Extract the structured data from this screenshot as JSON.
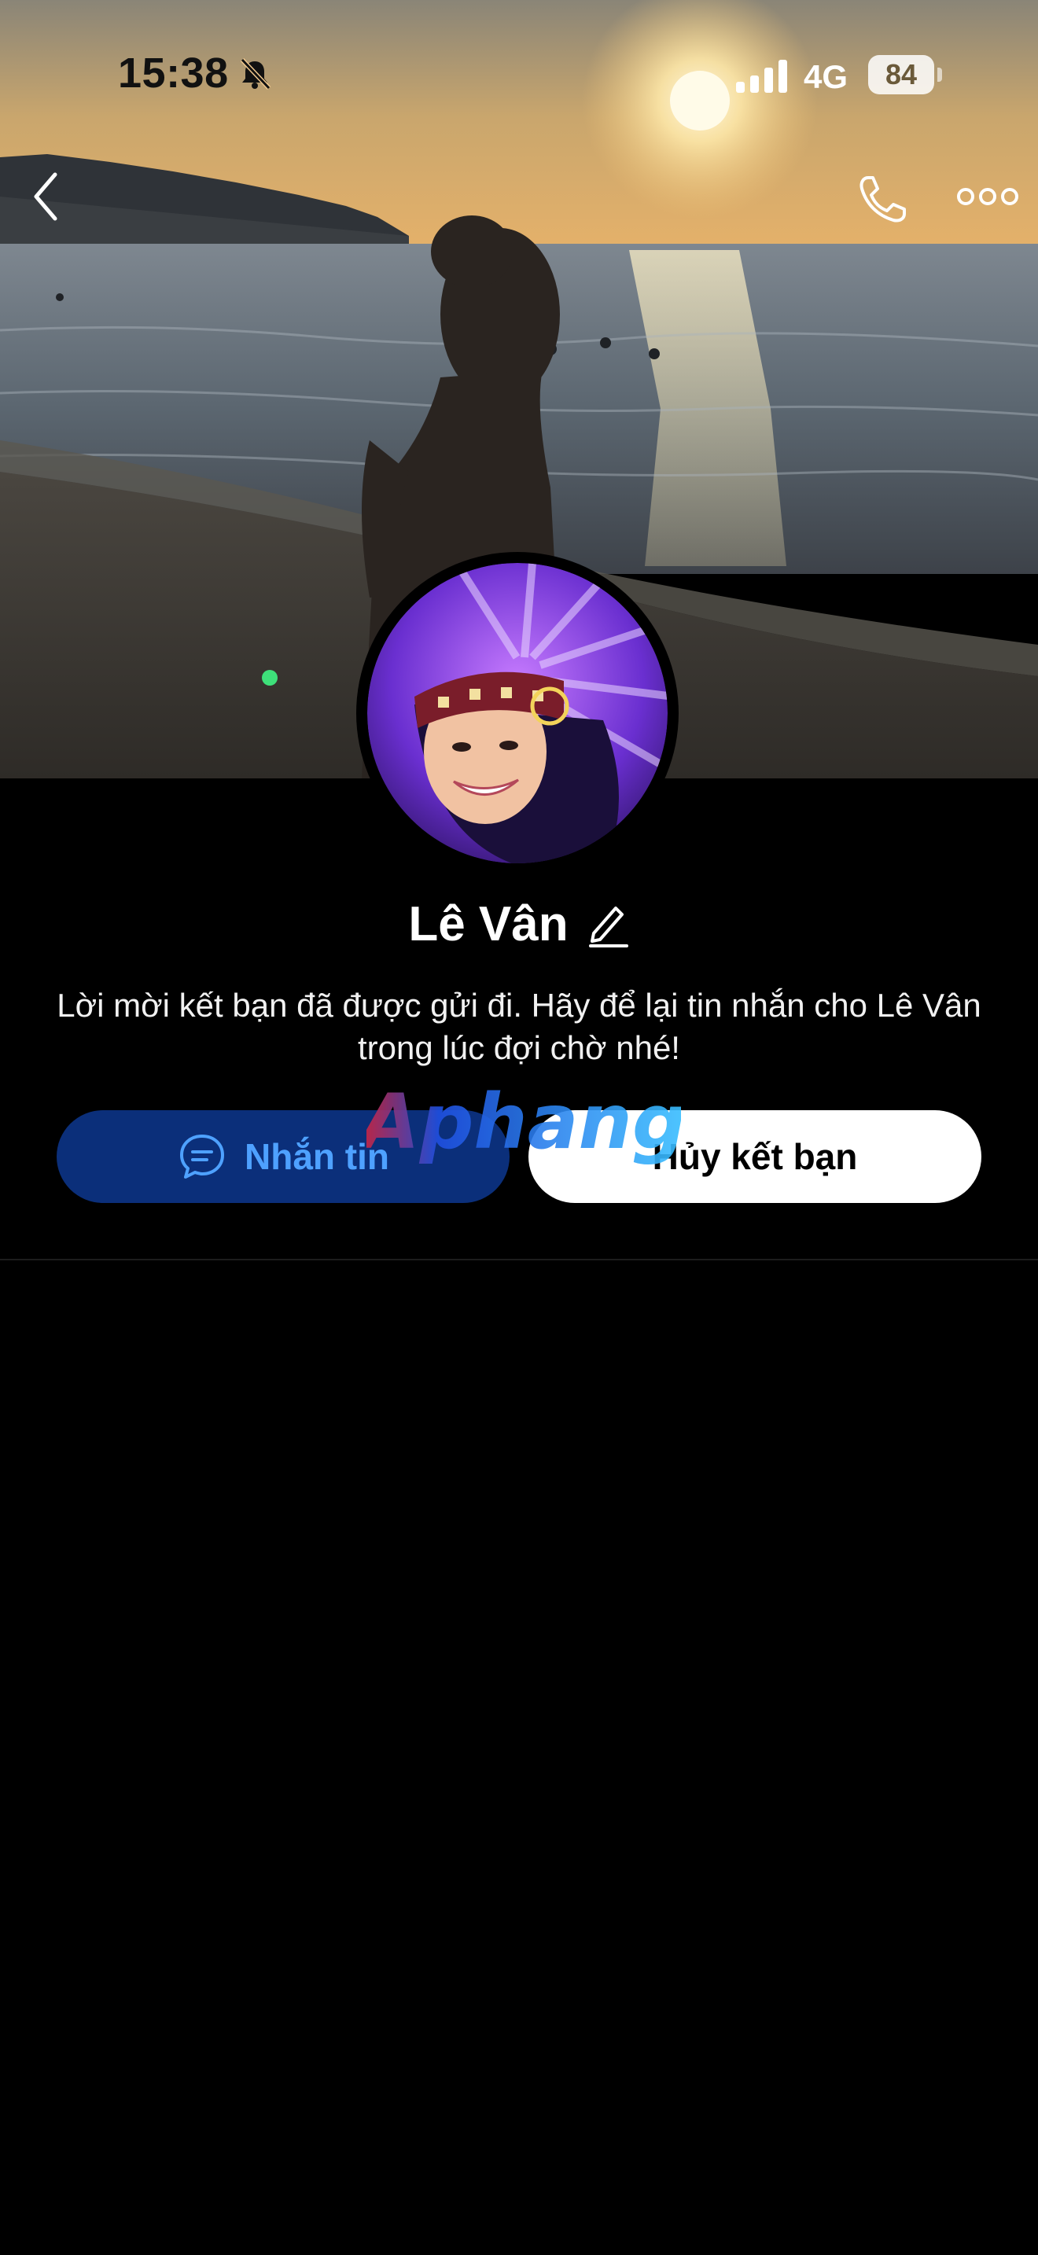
{
  "status_bar": {
    "time": "15:38",
    "network": "4G",
    "battery": "84"
  },
  "icons": {
    "back": "chevron-left-icon",
    "call": "phone-icon",
    "more": "more-horizontal-icon",
    "edit": "pencil-icon",
    "chat": "chat-bubble-icon",
    "bell_muted": "bell-off-icon",
    "signal": "cellular-signal-icon"
  },
  "profile": {
    "name": "Lê Vân",
    "message": "Lời mời kết bạn đã được gửi đi. Hãy để lại tin nhắn cho Lê Vân trong lúc đợi chờ nhé!"
  },
  "actions": {
    "message_label": "Nhắn tin",
    "unfriend_label": "Hủy kết bạn"
  },
  "watermark": {
    "text": "Aphang"
  },
  "colors": {
    "background": "#000000",
    "message_button_bg": "#0b2f7a",
    "message_button_text": "#4ea1ff",
    "unfriend_button_bg": "#ffffff",
    "online_dot": "#3ee07a"
  }
}
